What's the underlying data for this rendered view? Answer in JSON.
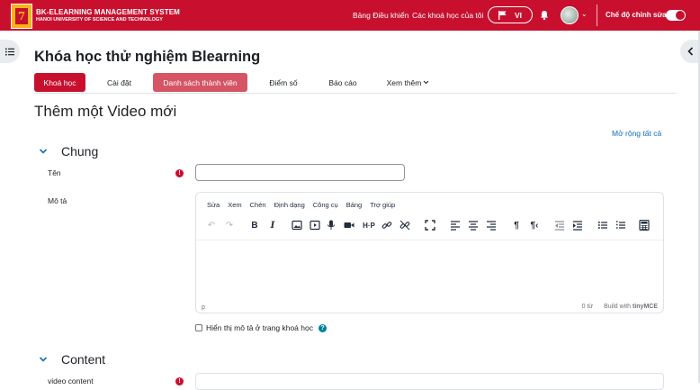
{
  "header": {
    "brand_title": "BK-ELEARNING MANAGEMENT SYSTEM",
    "brand_subtitle": "HANOI UNIVERSITY OF SCIENCE AND TECHNOLOGY",
    "logo_glyph": "7",
    "nav_dashboard": "Bảng Điều khiển",
    "nav_my_courses": "Các khoá học của tôi",
    "language": "VI",
    "edit_mode_label": "Chế độ chỉnh sửa",
    "edit_mode_on": true,
    "brand_color": "#c8102e"
  },
  "course": {
    "title": "Khóa học thử nghiệm Blearning",
    "tabs": [
      {
        "label": "Khoá học",
        "state": "active"
      },
      {
        "label": "Cài đặt",
        "state": "normal"
      },
      {
        "label": "Danh sách thành viên",
        "state": "highlighted"
      },
      {
        "label": "Điểm số",
        "state": "normal"
      },
      {
        "label": "Báo cáo",
        "state": "normal"
      },
      {
        "label": "Xem thêm",
        "state": "dropdown"
      }
    ]
  },
  "form": {
    "heading": "Thêm một Video mới",
    "expand_all": "Mở rộng tất cả",
    "section_general": "Chung",
    "name_label": "Tên",
    "name_value": "",
    "description_label": "Mô tả",
    "editor_menu": [
      "Sửa",
      "Xem",
      "Chèn",
      "Định dạng",
      "Công cụ",
      "Bảng",
      "Trợ giúp"
    ],
    "editor_path": "p",
    "word_count": "0 từ",
    "built_with": "Build with",
    "tinymce": "tinyMCE",
    "show_description_label": "Hiển thị mô tả ở trang khoá học",
    "show_description_checked": false,
    "section_content": "Content",
    "video_content_label": "video content"
  },
  "icons": {
    "required": "!",
    "help": "?",
    "left_drawer": "list-icon",
    "right_drawer": "chevron-left-icon"
  }
}
